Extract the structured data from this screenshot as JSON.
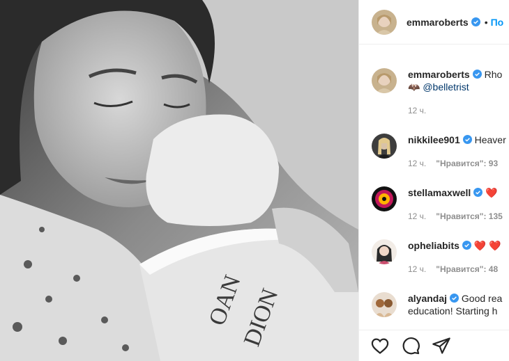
{
  "header": {
    "username": "emmaroberts",
    "dot": "•",
    "follow": "По"
  },
  "caption": {
    "username": "emmaroberts",
    "text": "Rho",
    "emoji": "🦇",
    "mention": "@belletrist",
    "time": "12 ч."
  },
  "comments": [
    {
      "username": "nikkilee901",
      "text": "Heaver",
      "time": "12 ч.",
      "likes": "\"Нравится\": 93"
    },
    {
      "username": "stellamaxwell",
      "text": "❤️",
      "time": "12 ч.",
      "likes": "\"Нравится\": 135"
    },
    {
      "username": "opheliabits",
      "text": "❤️ ❤️",
      "time": "12 ч.",
      "likes": "\"Нравится\": 48"
    },
    {
      "username": "alyandaj",
      "text": "Good rea",
      "text2": "education! Starting h"
    }
  ],
  "icons": [
    "heart-icon",
    "comment-icon",
    "share-icon"
  ],
  "colors": {
    "link": "#0095f6",
    "meta": "#8e8e8e",
    "verified": "#3897f0",
    "heart": "#ed4956"
  }
}
